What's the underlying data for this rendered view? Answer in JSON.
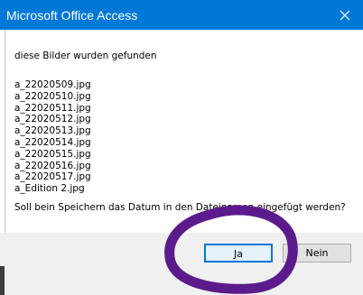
{
  "window": {
    "title": "Microsoft Office Access",
    "close_icon": "close-icon"
  },
  "message": {
    "intro": "diese Bilder wurden gefunden",
    "files": [
      "a_22020509.jpg",
      "a_22020510.jpg",
      "a_22020511.jpg",
      "a_22020512.jpg",
      "a_22020513.jpg",
      "a_22020514.jpg",
      "a_22020515.jpg",
      "a_22020516.jpg",
      "a_22020517.jpg",
      "a_Edition 2.jpg"
    ],
    "question": "Soll bein Speichern das Datum in den Dateinamen eingefügt werden?"
  },
  "buttons": {
    "yes_label": "Ja",
    "no_label": "Nein"
  },
  "colors": {
    "titlebar": "#0078d7",
    "annotation": "#5b1b8c",
    "default_button_border": "#0078d7"
  }
}
